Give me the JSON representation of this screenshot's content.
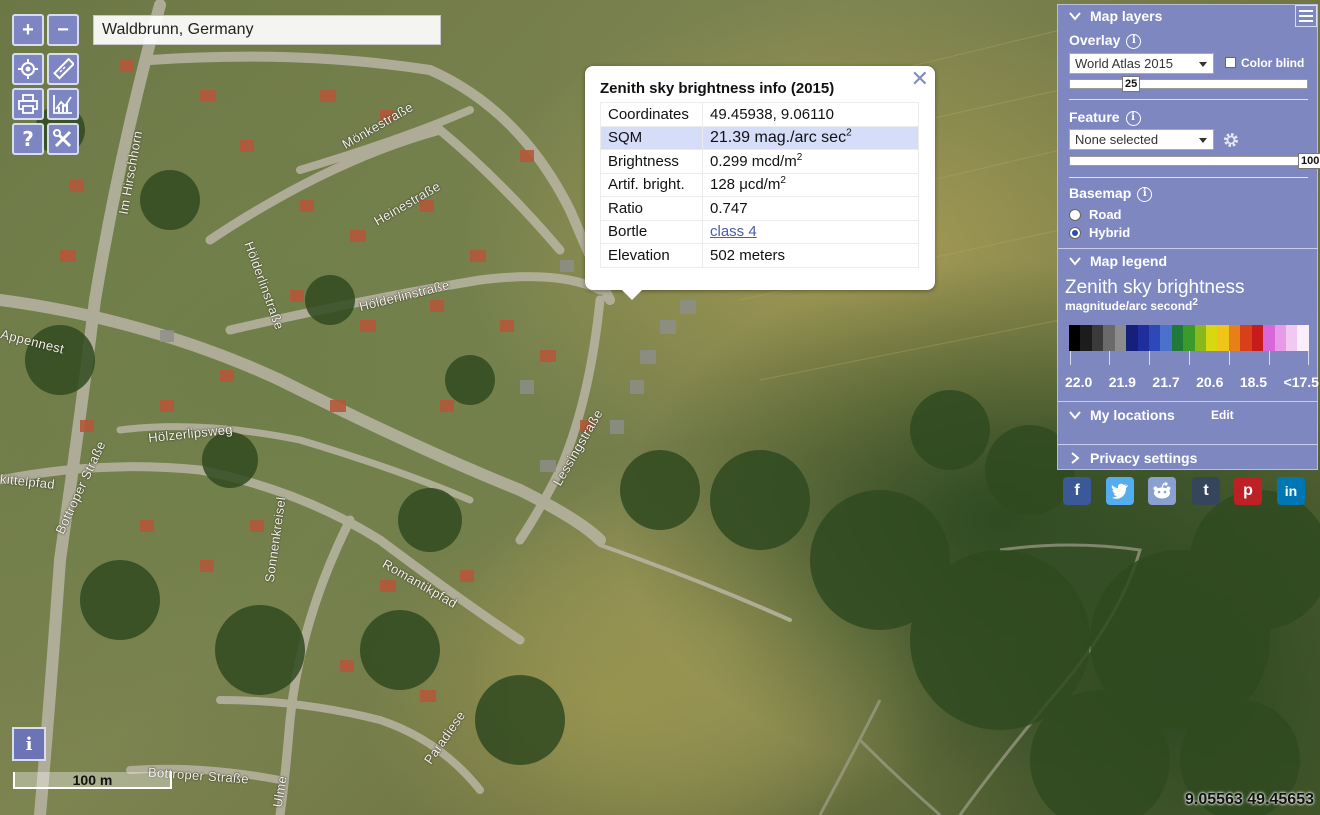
{
  "search": {
    "value": "Waldbrunn, Germany"
  },
  "map": {
    "street_labels": [
      "Mönkestraße",
      "Im Hirschhorn",
      "Heinestraße",
      "Hölderlinstraße",
      "Hölderlinstraße",
      "Appennest",
      "Hölzerlipsweg",
      "Lessingstraße",
      "kittelpfad",
      "Bottroper Straße",
      "Sonnenkreisel",
      "Romantikpfad",
      "Paradiese",
      "Bottroper Straße",
      "Ulme"
    ],
    "scale_label": "100 m",
    "coordinates_readout": "9.05563 49.45653"
  },
  "tools": {
    "zoom_in": "+",
    "zoom_out": "−",
    "help": "?",
    "info": "i"
  },
  "popup": {
    "title": "Zenith sky brightness info (2015)",
    "close": "✕",
    "rows": [
      {
        "key": "Coordinates",
        "value": "49.45938, 9.06110"
      },
      {
        "key": "SQM",
        "value": "21.39 mag./arc sec",
        "sup": "2"
      },
      {
        "key": "Brightness",
        "value": "0.299 mcd/m",
        "sup": "2"
      },
      {
        "key": "Artif. bright.",
        "value": "128 μcd/m",
        "sup": "2"
      },
      {
        "key": "Ratio",
        "value": "0.747"
      },
      {
        "key": "Bortle",
        "value": "class 4"
      },
      {
        "key": "Elevation",
        "value": "502 meters"
      }
    ]
  },
  "panel": {
    "map_layers": "Map layers",
    "overlay_label": "Overlay",
    "overlay_value": "World Atlas 2015",
    "color_blind": "Color blind",
    "overlay_opacity": 25,
    "feature_label": "Feature",
    "feature_value": "None selected",
    "feature_opacity": 100,
    "basemap_label": "Basemap",
    "basemap_options": [
      "Road",
      "Hybrid"
    ],
    "basemap_selected": "Hybrid",
    "map_legend": "Map legend",
    "legend_title": "Zenith sky brightness",
    "legend_unit": "magnitude/arc second",
    "legend_unit_sup": "2",
    "legend_ticks": [
      "22.0",
      "21.9",
      "21.7",
      "20.6",
      "18.5",
      "<17.5"
    ],
    "legend_colors": [
      "#000000",
      "#1c1c1c",
      "#3a3a3a",
      "#6a6a6a",
      "#8c8c8c",
      "#16207a",
      "#1f2e9c",
      "#2f48b8",
      "#4a72cc",
      "#1f7a3a",
      "#3a9a2a",
      "#8ab81c",
      "#d8d812",
      "#f0c418",
      "#e88018",
      "#d8401c",
      "#c81c1c",
      "#d868d8",
      "#e89ae8",
      "#f0c8f0",
      "#faeefa"
    ],
    "my_locations": "My locations",
    "edit": "Edit",
    "privacy_settings": "Privacy settings"
  },
  "social": [
    {
      "name": "facebook",
      "glyph": "f",
      "color": "#3b5998"
    },
    {
      "name": "twitter",
      "glyph": "t",
      "color": "#55acee"
    },
    {
      "name": "reddit",
      "glyph": "r",
      "color": "#8aa0d0"
    },
    {
      "name": "tumblr",
      "glyph": "t",
      "color": "#35465c"
    },
    {
      "name": "pinterest",
      "glyph": "p",
      "color": "#bd2126"
    },
    {
      "name": "linkedin",
      "glyph": "in",
      "color": "#0077b5"
    }
  ]
}
